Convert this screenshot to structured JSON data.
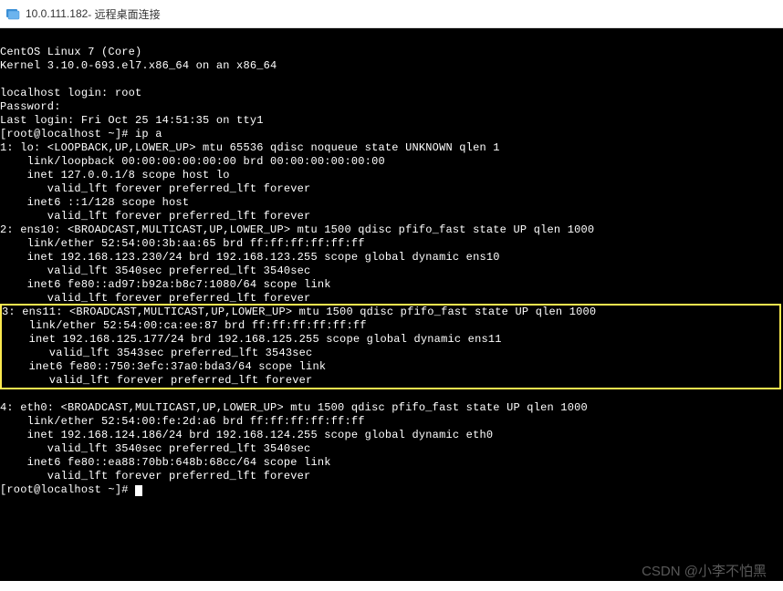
{
  "title": {
    "ip": "10.0.111.182",
    "suffix": " - 远程桌面连接"
  },
  "os": {
    "name": "CentOS Linux 7 (Core)",
    "kernel": "Kernel 3.10.0-693.el7.x86_64 on an x86_64"
  },
  "login": {
    "prompt": "localhost login: ",
    "user": "root",
    "password_label": "Password:",
    "last_login": "Last login: Fri Oct 25 14:51:35 on tty1"
  },
  "shell": {
    "prompt1": "[root@localhost ~]# ",
    "cmd1": "ip a",
    "prompt2": "[root@localhost ~]# "
  },
  "ifaces": {
    "lo": {
      "hdr": "1: lo: <LOOPBACK,UP,LOWER_UP> mtu 65536 qdisc noqueue state UNKNOWN qlen 1",
      "link": "    link/loopback 00:00:00:00:00:00 brd 00:00:00:00:00:00",
      "inet": "    inet 127.0.0.1/8 scope host lo",
      "valid1": "       valid_lft forever preferred_lft forever",
      "inet6": "    inet6 ::1/128 scope host",
      "valid2": "       valid_lft forever preferred_lft forever"
    },
    "ens10": {
      "hdr": "2: ens10: <BROADCAST,MULTICAST,UP,LOWER_UP> mtu 1500 qdisc pfifo_fast state UP qlen 1000",
      "link": "    link/ether 52:54:00:3b:aa:65 brd ff:ff:ff:ff:ff:ff",
      "inet": "    inet 192.168.123.230/24 brd 192.168.123.255 scope global dynamic ens10",
      "valid1": "       valid_lft 3540sec preferred_lft 3540sec",
      "inet6": "    inet6 fe80::ad97:b92a:b8c7:1080/64 scope link",
      "valid2": "       valid_lft forever preferred_lft forever"
    },
    "ens11": {
      "hdr": "3: ens11: <BROADCAST,MULTICAST,UP,LOWER_UP> mtu 1500 qdisc pfifo_fast state UP qlen 1000",
      "link": "    link/ether 52:54:00:ca:ee:87 brd ff:ff:ff:ff:ff:ff",
      "inet": "    inet 192.168.125.177/24 brd 192.168.125.255 scope global dynamic ens11",
      "valid1": "       valid_lft 3543sec preferred_lft 3543sec",
      "inet6": "    inet6 fe80::750:3efc:37a0:bda3/64 scope link",
      "valid2": "       valid_lft forever preferred_lft forever"
    },
    "eth0": {
      "hdr": "4: eth0: <BROADCAST,MULTICAST,UP,LOWER_UP> mtu 1500 qdisc pfifo_fast state UP qlen 1000",
      "link": "    link/ether 52:54:00:fe:2d:a6 brd ff:ff:ff:ff:ff:ff",
      "inet": "    inet 192.168.124.186/24 brd 192.168.124.255 scope global dynamic eth0",
      "valid1": "       valid_lft 3540sec preferred_lft 3540sec",
      "inet6": "    inet6 fe80::ea88:70bb:648b:68cc/64 scope link",
      "valid2": "       valid_lft forever preferred_lft forever"
    }
  },
  "watermark": "CSDN @小李不怕黑"
}
